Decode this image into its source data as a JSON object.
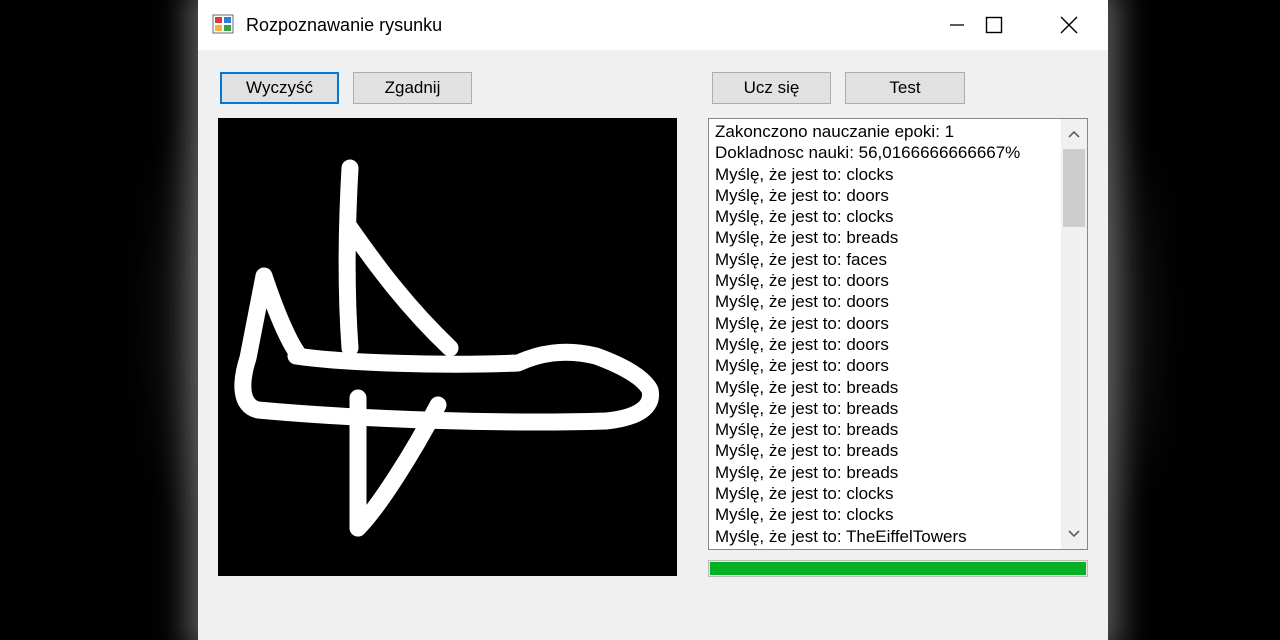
{
  "window": {
    "title": "Rozpoznawanie rysunku",
    "icon": "winforms-app-icon",
    "controls": [
      "minimize-icon",
      "maximize-icon",
      "close-icon"
    ]
  },
  "buttons": {
    "clear_label": "Wyczyść",
    "guess_label": "Zgadnij",
    "learn_label": "Ucz się",
    "test_label": "Test"
  },
  "log": {
    "lines": [
      "Zakonczono nauczanie epoki: 1",
      "Dokladnosc nauki: 56,0166666666667%",
      "Myślę, że jest to: clocks",
      "Myślę, że jest to: doors",
      "Myślę, że jest to: clocks",
      "Myślę, że jest to: breads",
      "Myślę, że jest to: faces",
      "Myślę, że jest to: doors",
      "Myślę, że jest to: doors",
      "Myślę, że jest to: doors",
      "Myślę, że jest to: doors",
      "Myślę, że jest to: doors",
      "Myślę, że jest to: breads",
      "Myślę, że jest to: breads",
      "Myślę, że jest to: breads",
      "Myślę, że jest to: breads",
      "Myślę, że jest to: breads",
      "Myślę, że jest to: clocks",
      "Myślę, że jest to: clocks",
      "Myślę, że jest to: TheEiffelTowers"
    ]
  },
  "progress": {
    "value": 1.0,
    "color": "#06b025"
  },
  "colors": {
    "focus_border": "#0078d7",
    "canvas_bg": "#000000",
    "stroke": "#ffffff"
  }
}
